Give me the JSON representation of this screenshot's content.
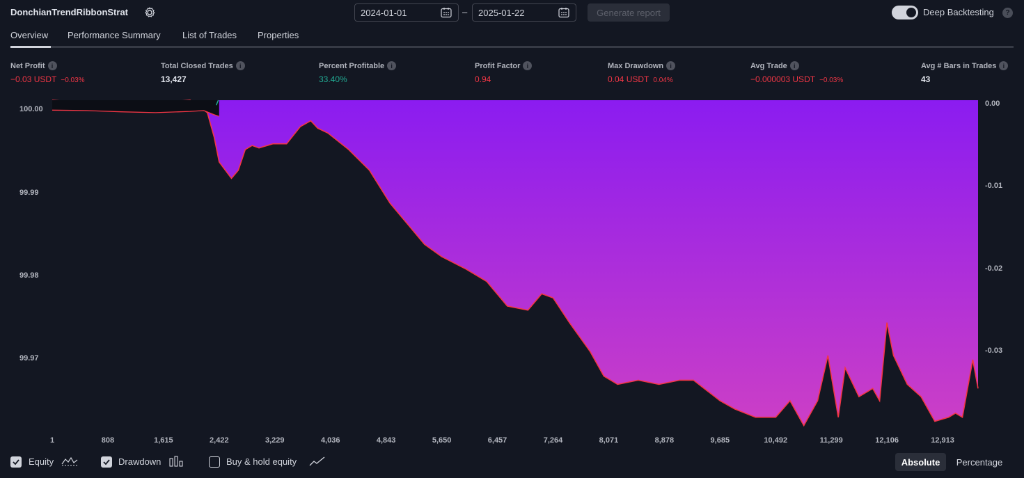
{
  "header": {
    "strategy_name": "DonchianTrendRibbonStrat",
    "start_date": "2024-01-01",
    "end_date": "2025-01-22",
    "range_dash": "–",
    "generate_label": "Generate report",
    "deep_backtesting_label": "Deep Backtesting",
    "deep_backtesting_on": true,
    "help_glyph": "?"
  },
  "tabs": [
    {
      "label": "Overview",
      "active": true
    },
    {
      "label": "Performance Summary",
      "active": false
    },
    {
      "label": "List of Trades",
      "active": false
    },
    {
      "label": "Properties",
      "active": false
    }
  ],
  "metrics": [
    {
      "label": "Net Profit",
      "value": "−0.03 USDT",
      "sub": "−0.03%",
      "color": "red"
    },
    {
      "label": "Total Closed Trades",
      "value": "13,427",
      "sub": "",
      "color": "white"
    },
    {
      "label": "Percent Profitable",
      "value": "33.40%",
      "sub": "",
      "color": "green"
    },
    {
      "label": "Profit Factor",
      "value": "0.94",
      "sub": "",
      "color": "red"
    },
    {
      "label": "Max Drawdown",
      "value": "0.04 USDT",
      "sub": "0.04%",
      "color": "red"
    },
    {
      "label": "Avg Trade",
      "value": "−0.000003 USDT",
      "sub": "−0.03%",
      "color": "red"
    },
    {
      "label": "Avg # Bars in Trades",
      "value": "43",
      "sub": "",
      "color": "white"
    }
  ],
  "info_glyph": "i",
  "chart_data": {
    "type": "area",
    "x_ticks": [
      "1",
      "808",
      "1,615",
      "2,422",
      "3,229",
      "4,036",
      "4,843",
      "5,650",
      "6,457",
      "7,264",
      "8,071",
      "8,878",
      "9,685",
      "10,492",
      "11,299",
      "12,106",
      "12,913"
    ],
    "x_tick_values": [
      1,
      808,
      1615,
      2422,
      3229,
      4036,
      4843,
      5650,
      6457,
      7264,
      8071,
      8878,
      9685,
      10492,
      11299,
      12106,
      12913
    ],
    "xlim": [
      1,
      13427
    ],
    "left_axis_ticks": [
      "100.00",
      "99.99",
      "99.98",
      "99.97"
    ],
    "left_axis_values": [
      100.0,
      99.99,
      99.98,
      99.97
    ],
    "left_ylim": [
      99.9623,
      100.0012
    ],
    "right_axis_ticks": [
      "0.00",
      "-0.01",
      "-0.02",
      "-0.03"
    ],
    "right_axis_values": [
      0.0,
      -0.01,
      -0.02,
      -0.03
    ],
    "right_ylim": [
      -0.0392,
      0.0
    ],
    "colors": {
      "drawdown_top": "#8b1cf0",
      "drawdown_bottom": "#cc3fc6",
      "equity_line": "#f23645",
      "equity_fill": "#0c0e15",
      "buyhold_up": "#22ab94"
    },
    "series": [
      {
        "kind": "drawdown",
        "x": [
          1,
          500,
          1000,
          1500,
          2000,
          2250,
          2350,
          2422,
          2600,
          2700,
          2800,
          2900,
          3000,
          3200,
          3400,
          3600,
          3750,
          3850,
          4000,
          4300,
          4600,
          4900,
          5200,
          5400,
          5650,
          6000,
          6300,
          6600,
          6900,
          7100,
          7264,
          7500,
          7800,
          8000,
          8200,
          8500,
          8800,
          9100,
          9300,
          9685,
          9900,
          10200,
          10492,
          10700,
          10900,
          11100,
          11250,
          11400,
          11500,
          11700,
          11900,
          12000,
          12106,
          12200,
          12400,
          12600,
          12800,
          13000,
          13100,
          13200,
          13350,
          13427
        ],
        "y": [
          0.0,
          -0.0003,
          -0.0004,
          -0.0003,
          0.0,
          -0.0015,
          -0.0045,
          -0.0075,
          -0.0095,
          -0.0085,
          -0.006,
          -0.0055,
          -0.0058,
          -0.0053,
          -0.0053,
          -0.0032,
          -0.0025,
          -0.0034,
          -0.004,
          -0.006,
          -0.0085,
          -0.0125,
          -0.0155,
          -0.0175,
          -0.019,
          -0.0205,
          -0.022,
          -0.025,
          -0.0255,
          -0.0235,
          -0.024,
          -0.027,
          -0.0305,
          -0.0335,
          -0.0345,
          -0.034,
          -0.0345,
          -0.034,
          -0.034,
          -0.0365,
          -0.0375,
          -0.0385,
          -0.0385,
          -0.0365,
          -0.0395,
          -0.0365,
          -0.031,
          -0.0385,
          -0.0325,
          -0.036,
          -0.035,
          -0.0365,
          -0.027,
          -0.031,
          -0.0345,
          -0.036,
          -0.039,
          -0.0385,
          -0.038,
          -0.0385,
          -0.0315,
          -0.035
        ]
      },
      {
        "kind": "equity",
        "x": [
          1,
          500,
          1000,
          1500,
          2000,
          2200,
          2350,
          2422
        ],
        "y": [
          100.0,
          99.99995,
          99.9998,
          99.9997,
          99.99985,
          99.99995,
          99.99945,
          99.99925
        ]
      }
    ]
  },
  "footer": {
    "legend": [
      {
        "label": "Equity",
        "checked": true
      },
      {
        "label": "Drawdown",
        "checked": true
      },
      {
        "label": "Buy & hold equity",
        "checked": false
      }
    ],
    "absolute_label": "Absolute",
    "percentage_label": "Percentage"
  }
}
